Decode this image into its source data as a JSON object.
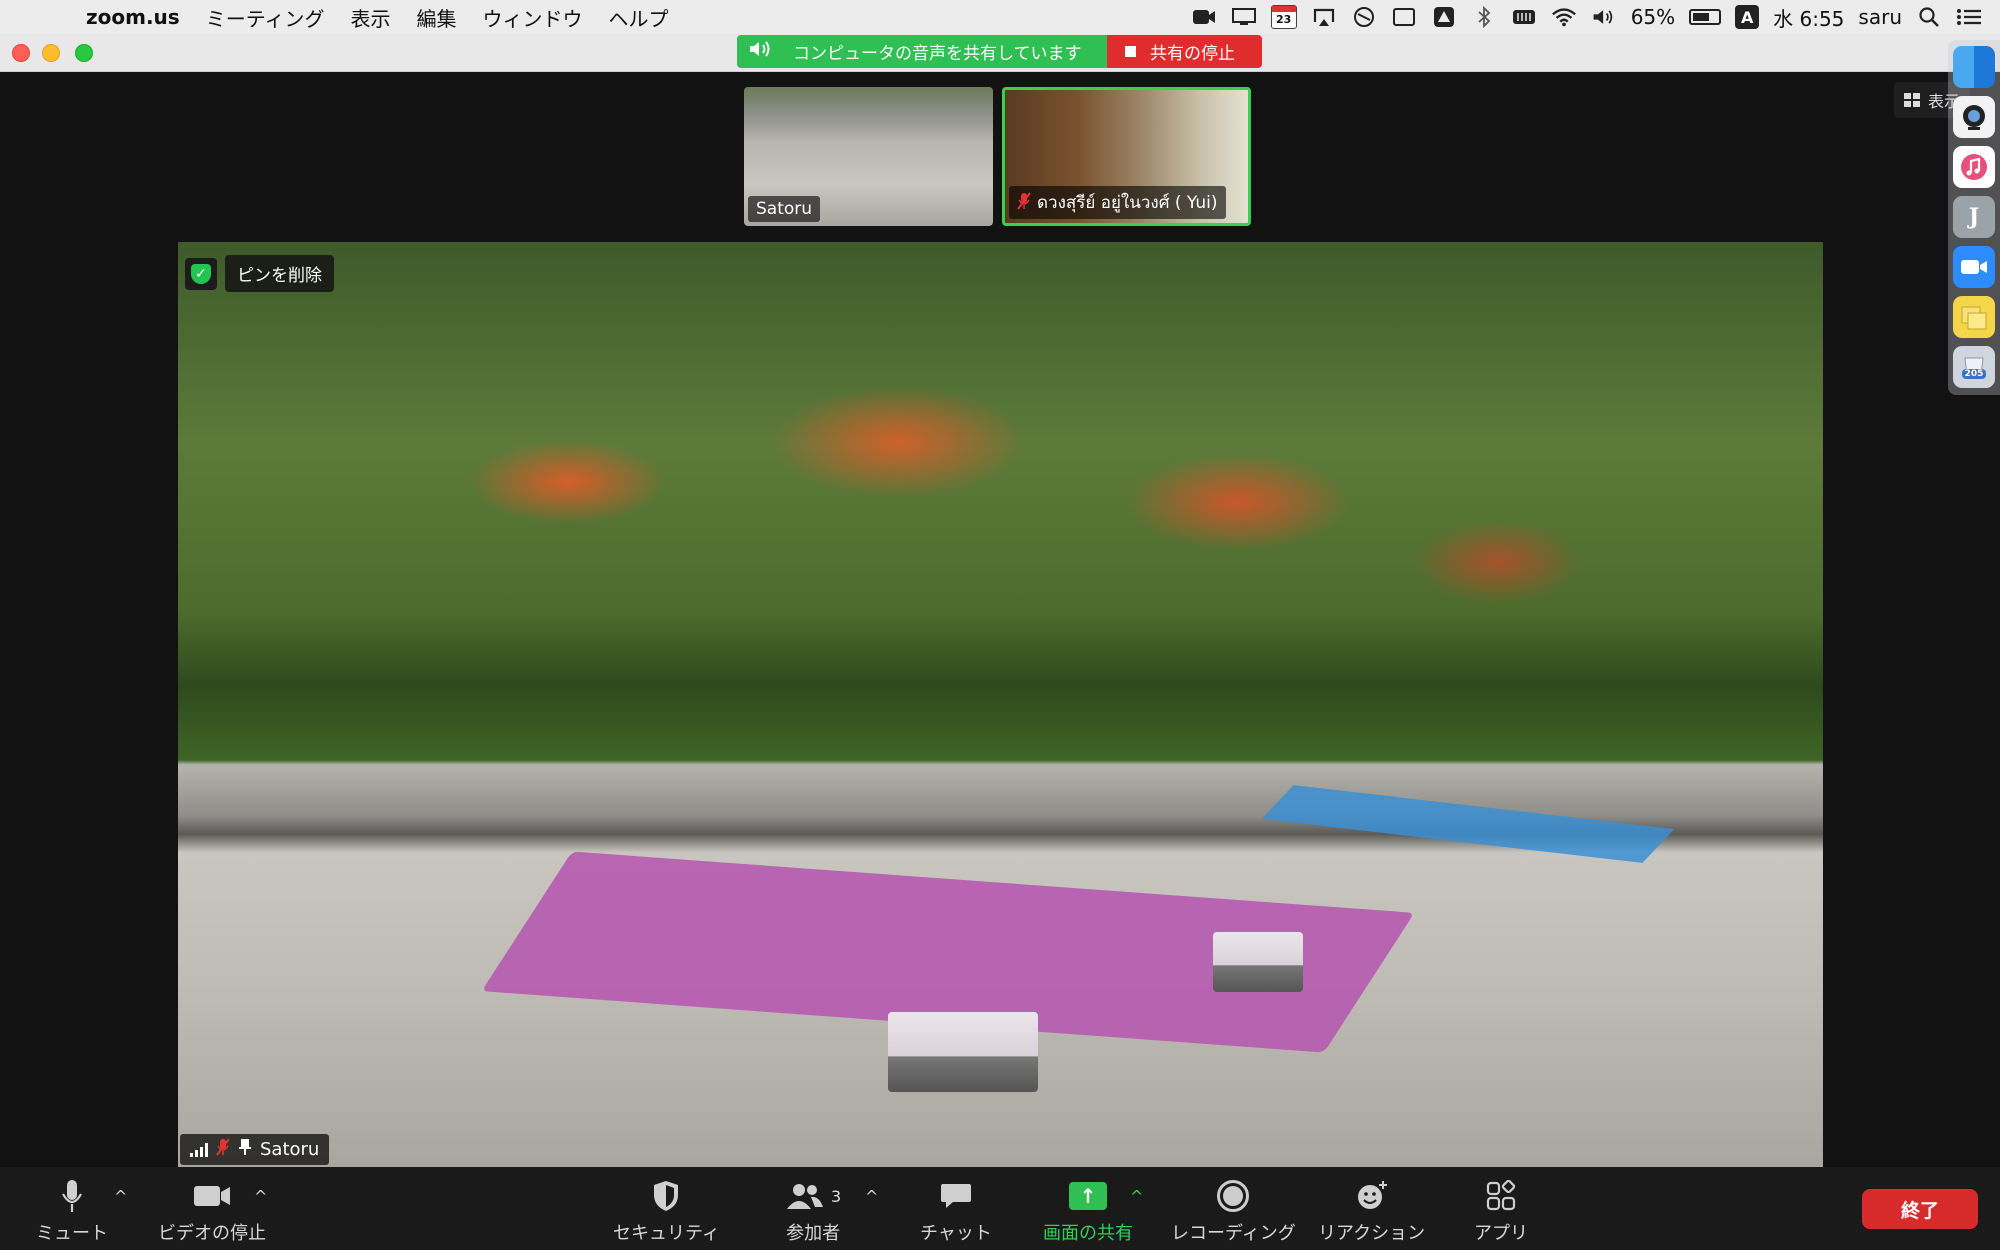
{
  "menubar": {
    "app_name": "zoom.us",
    "menus": [
      "ミーティング",
      "表示",
      "編集",
      "ウィンドウ",
      "ヘルプ"
    ],
    "calendar_day": "23",
    "battery_percent": "65%",
    "input_source": "A",
    "clock": "水 6:55",
    "user": "saru",
    "battery_level": 0.65
  },
  "share_banner": {
    "status": "コンピュータの音声を共有しています",
    "stop_label": "共有の停止"
  },
  "thumbnails": [
    {
      "name": "Satoru"
    },
    {
      "name": "ดวงสุรีย์ อยู่ในวงศ์ ( Yui)"
    }
  ],
  "view_button": {
    "label": "表示"
  },
  "main_video": {
    "unpin_label": "ピンを削除",
    "participant_name": "Satoru"
  },
  "dock": {
    "calendar_badge": "205"
  },
  "toolbar": {
    "mute": "ミュート",
    "stop_video": "ビデオの停止",
    "security": "セキュリティ",
    "participants": "参加者",
    "participant_count": "3",
    "chat": "チャット",
    "share_screen": "画面の共有",
    "recording": "レコーディング",
    "reactions": "リアクション",
    "apps": "アプリ",
    "end": "終了"
  },
  "colors": {
    "share_green": "#2fbf53",
    "stop_red": "#e02c2c",
    "end_red": "#d72a2a",
    "active_border": "#38d14d"
  }
}
